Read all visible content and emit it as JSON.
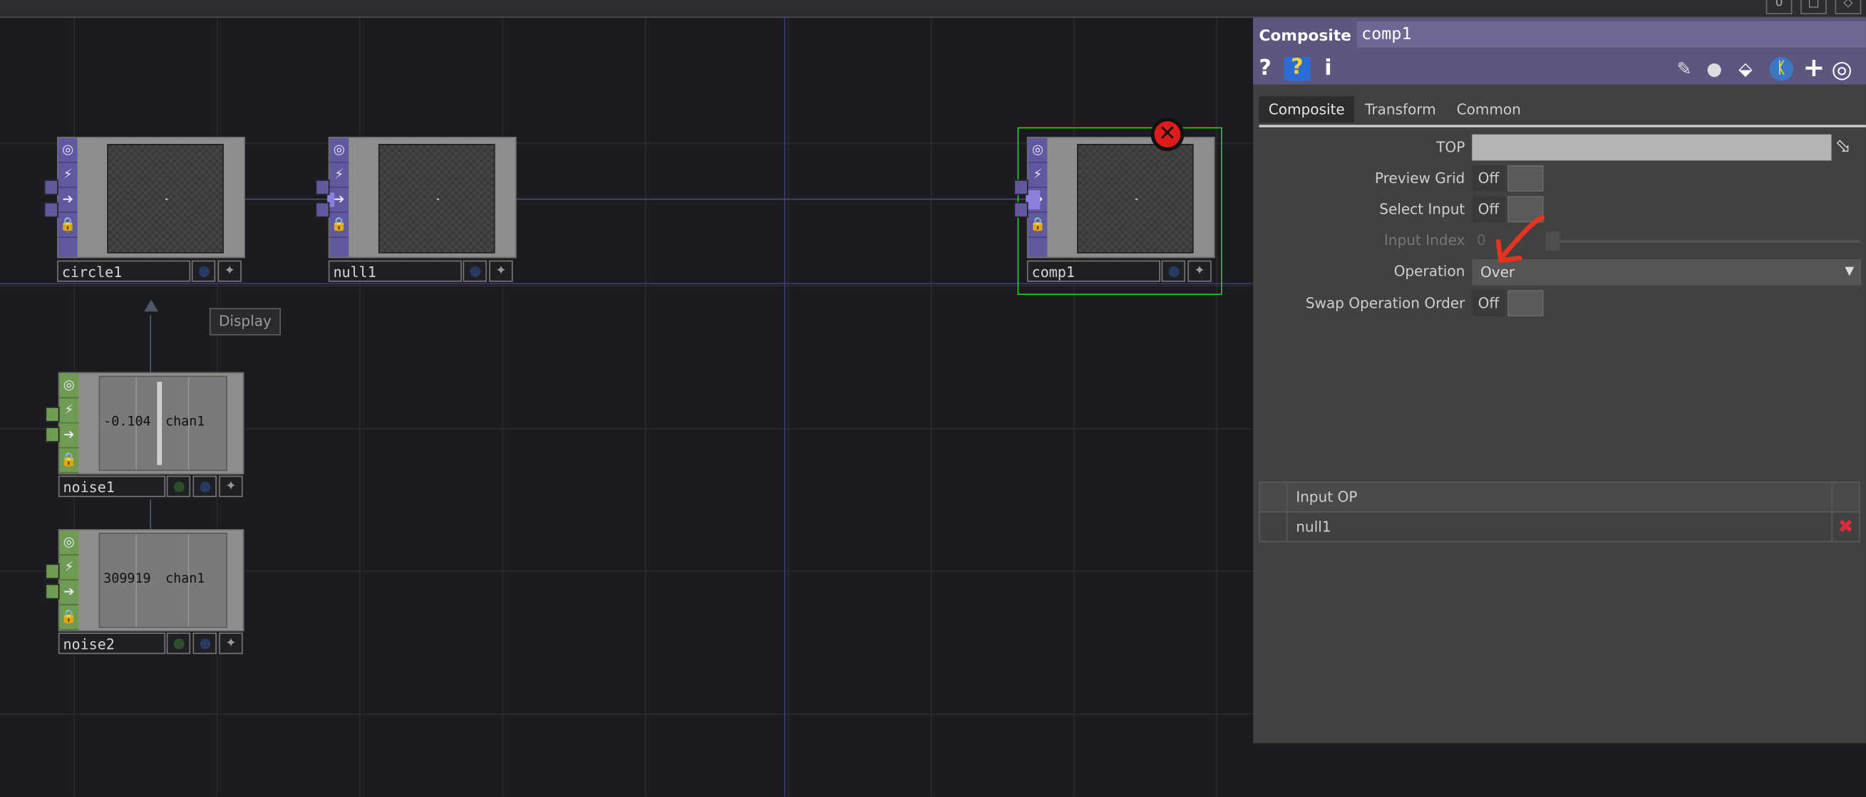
{
  "network": {
    "tooltip": "Display",
    "nodes": {
      "circle1": {
        "name": "circle1"
      },
      "null1": {
        "name": "null1"
      },
      "comp1": {
        "name": "comp1"
      },
      "noise1": {
        "name": "noise1",
        "value": "-0.104",
        "channel": "chan1"
      },
      "noise2": {
        "name": "noise2",
        "value": "309919",
        "channel": "chan1"
      }
    }
  },
  "panel": {
    "op_type": "Composite",
    "op_name": "comp1",
    "tabs": [
      "Composite",
      "Transform",
      "Common"
    ],
    "params": {
      "top_label": "TOP",
      "preview_grid_label": "Preview Grid",
      "preview_grid_value": "Off",
      "select_input_label": "Select Input",
      "select_input_value": "Off",
      "input_index_label": "Input Index",
      "input_index_value": "0",
      "operation_label": "Operation",
      "operation_value": "Over",
      "swap_label": "Swap Operation Order",
      "swap_value": "Off"
    },
    "table": {
      "header": "Input OP",
      "rows": [
        "null1"
      ]
    }
  },
  "window_buttons": [
    "0",
    "□",
    "◇"
  ],
  "colors": {
    "top_flag": "#5f59a0",
    "chop_flag": "#6f9b52",
    "header": "#5d5780",
    "error": "#e01b1b",
    "annotation": "#e8331e"
  }
}
